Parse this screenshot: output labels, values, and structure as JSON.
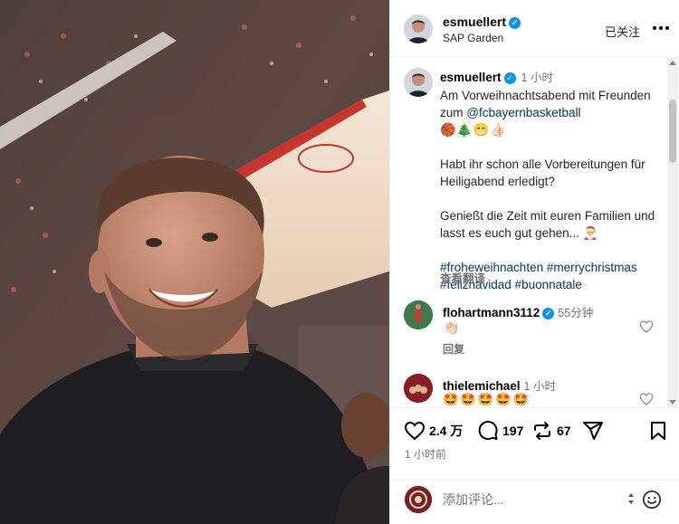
{
  "photo": {
    "alt_icon": "selfie-photo"
  },
  "header": {
    "username": "esmuellert",
    "location": "SAP Garden",
    "follow_label": "已关注"
  },
  "caption": {
    "username": "esmuellert",
    "time": "1 小时",
    "line1": "Am Vorweihnachtsabend mit Freunden zum ",
    "mention": "@fcbayernbasketball",
    "emojis": "🏀🎄😁👍🏻",
    "para2": "Habt ihr schon alle Vorbereitungen für Heiligabend erledigt?",
    "para3": "Genießt die Zeit mit euren Familien und lasst es euch gut gehen... 🎅",
    "hashtags": "#froheweihnachten #merrychristmas #feliznavidad #buonnatale",
    "translate_label": "查看翻译"
  },
  "comments": [
    {
      "username": "flohartmann3112",
      "time": "55分钟",
      "text": "👏🏻",
      "reply_label": "回复"
    },
    {
      "username": "thielemichael",
      "time": "1 小时",
      "text": "🤩🤩🤩🤩🤩"
    }
  ],
  "actions": {
    "likes": "2.4 万",
    "comments": "197",
    "reposts": "67",
    "posted_ago": "1 小时前"
  },
  "comment_bar": {
    "placeholder": "添加评论..."
  },
  "colors": {
    "link": "#00376b",
    "verified": "#0095f6",
    "muted": "#737373"
  }
}
